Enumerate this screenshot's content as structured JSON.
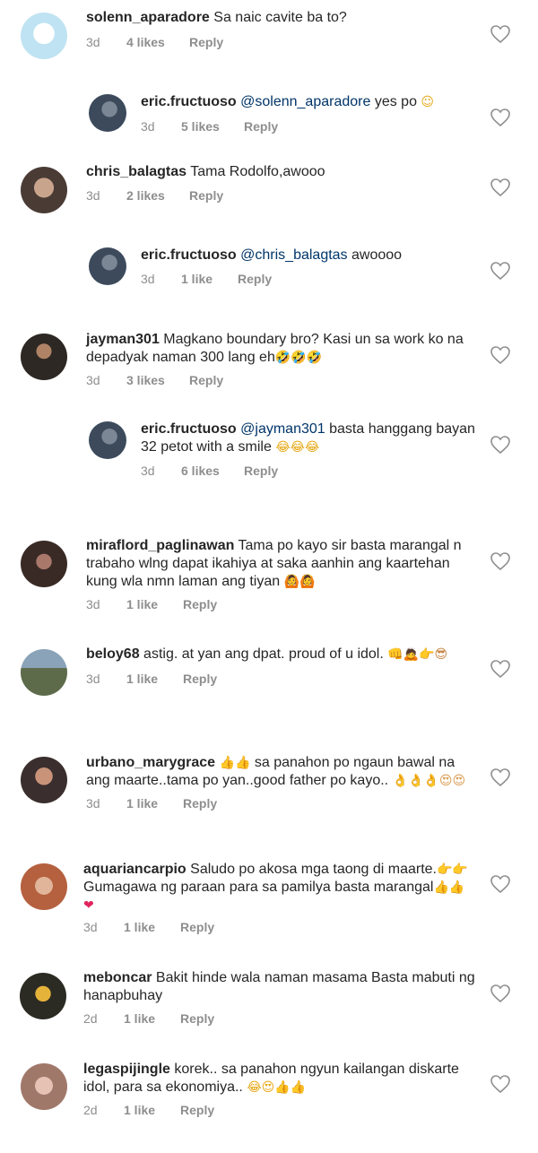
{
  "comments": [
    {
      "user": "solenn_aparadore",
      "mention": "",
      "text": "Sa naic cavite ba to?",
      "time": "3d",
      "likes": "4 likes",
      "reply": "Reply",
      "emoji": "",
      "avatar_color": "#bfe3f2"
    },
    {
      "user": "eric.fructuoso",
      "mention": "@solenn_aparadore",
      "text": "yes po",
      "time": "3d",
      "likes": "5 likes",
      "reply": "Reply",
      "emoji": "☺",
      "avatar_color": "#3c4a5c"
    },
    {
      "user": "chris_balagtas",
      "mention": "",
      "text": "Tama Rodolfo,awooo",
      "time": "3d",
      "likes": "2 likes",
      "reply": "Reply",
      "emoji": "",
      "avatar_color": "#4a3c35"
    },
    {
      "user": "eric.fructuoso",
      "mention": "@chris_balagtas",
      "text": "awoooo",
      "time": "3d",
      "likes": "1 like",
      "reply": "Reply",
      "emoji": "",
      "avatar_color": "#3c4a5c"
    },
    {
      "user": "jayman301",
      "mention": "",
      "text": "Magkano boundary bro? Kasi un sa work ko na depadyak naman 300 lang eh",
      "time": "3d",
      "likes": "3 likes",
      "reply": "Reply",
      "emoji": "🤣🤣🤣",
      "avatar_color": "#2d2824"
    },
    {
      "user": "eric.fructuoso",
      "mention": "@jayman301",
      "text": "basta hanggang bayan 32 petot with a smile",
      "time": "3d",
      "likes": "6 likes",
      "reply": "Reply",
      "emoji": "😂😂😂",
      "avatar_color": "#3c4a5c"
    },
    {
      "user": "miraflord_paglinawan",
      "mention": "",
      "text": "Tama po kayo sir basta marangal n trabaho wlng dapat ikahiya at saka aanhin ang kaartehan kung wla nmn laman ang tiyan",
      "time": "3d",
      "likes": "1 like",
      "reply": "Reply",
      "emoji": "🙆🙆",
      "avatar_color": "#3a2a26"
    },
    {
      "user": "beloy68",
      "mention": "",
      "text": "astig. at yan ang dpat. proud of u idol.",
      "time": "3d",
      "likes": "1 like",
      "reply": "Reply",
      "emoji": "👊🙇👉😎",
      "avatar_color": "#5d6b4a"
    },
    {
      "user": "urbano_marygrace",
      "mention": "",
      "text": "sa panahon po ngaun bawal na ang maarte..tama po yan..good father po kayo..",
      "time": "3d",
      "likes": "1 like",
      "reply": "Reply",
      "emoji_lead": "👍👍",
      "emoji": "👌👌👌😍😍",
      "avatar_color": "#3b2e2e"
    },
    {
      "user": "aquariancarpio",
      "mention": "",
      "text": "Saludo po akosa mga taong di maarte.",
      "time": "3d",
      "likes": "1 like",
      "reply": "Reply",
      "text2": "Gumagawa ng paraan para sa pamilya basta marangal",
      "emoji_mid": "👉👉",
      "emoji": "👍👍",
      "emoji3": "❤",
      "avatar_color": "#b5603e"
    },
    {
      "user": "meboncar",
      "mention": "",
      "text": "Bakit hinde wala naman masama Basta mabuti ng hanapbuhay",
      "time": "2d",
      "likes": "1 like",
      "reply": "Reply",
      "emoji": "",
      "avatar_color": "#2b2b24"
    },
    {
      "user": "legaspijingle",
      "mention": "",
      "text": "korek.. sa panahon ngyun kailangan diskarte idol, para sa ekonomiya..",
      "time": "2d",
      "likes": "1 like",
      "reply": "Reply",
      "emoji": "😂😍👍👍",
      "avatar_color": "#a0786a"
    }
  ]
}
